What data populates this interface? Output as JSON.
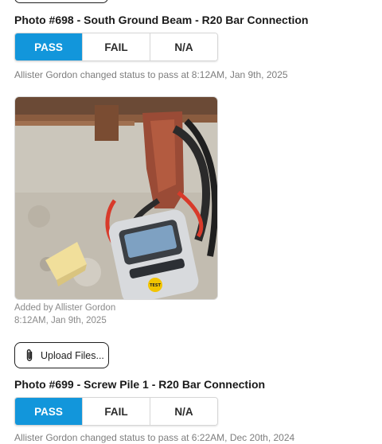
{
  "sections": [
    {
      "title": "Photo #698 - South Ground Beam - R20 Bar Connection",
      "options": [
        "PASS",
        "FAIL",
        "N/A"
      ],
      "selected": "PASS",
      "status_text": "Allister Gordon changed status to pass at 8:12AM, Jan 9th, 2025"
    },
    {
      "title": "Photo #699 - Screw Pile 1 - R20 Bar Connection",
      "options": [
        "PASS",
        "FAIL",
        "N/A"
      ],
      "selected": "PASS",
      "status_text": "Allister Gordon changed status to pass at 6:22AM, Dec 20th, 2024"
    }
  ],
  "attachment": {
    "added_by": "Added by Allister Gordon",
    "timestamp": "8:12AM, Jan 9th, 2025",
    "device_label": "TEST"
  },
  "upload": {
    "label": "Upload Files...",
    "icon": "paperclip-icon"
  },
  "colors": {
    "accent": "#1296db",
    "muted_text": "#7d7d7d"
  }
}
